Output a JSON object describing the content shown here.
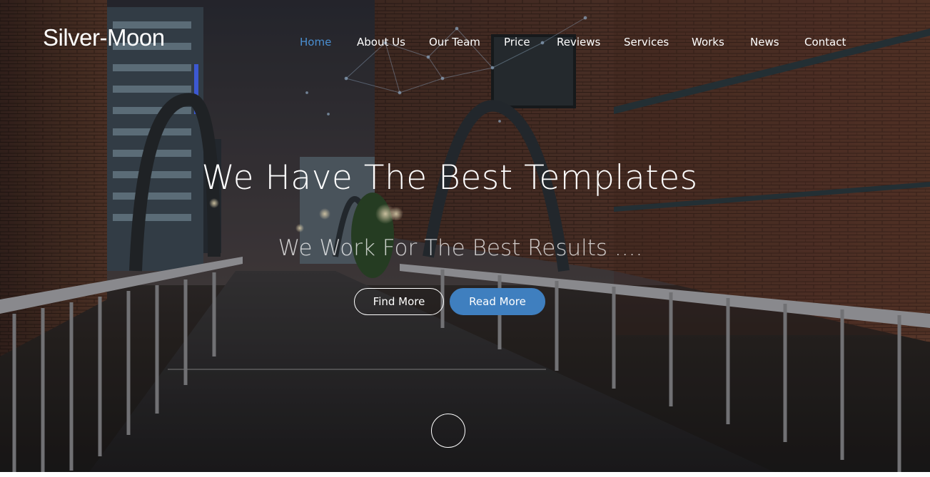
{
  "brand": {
    "name": "Silver-Moon"
  },
  "nav": {
    "items": [
      {
        "label": "Home",
        "active": true
      },
      {
        "label": "About Us"
      },
      {
        "label": "Our Team"
      },
      {
        "label": "Price"
      },
      {
        "label": "Reviews"
      },
      {
        "label": "Services"
      },
      {
        "label": "Works"
      },
      {
        "label": "News"
      },
      {
        "label": "Contact"
      }
    ]
  },
  "hero": {
    "headline": "We Have The Best Templates",
    "subline": "We Work For The Best Results ....",
    "buttons": {
      "find_more": "Find More",
      "read_more": "Read More"
    }
  },
  "colors": {
    "accent": "#4a8fd1",
    "button_primary": "#3f7fbf"
  }
}
